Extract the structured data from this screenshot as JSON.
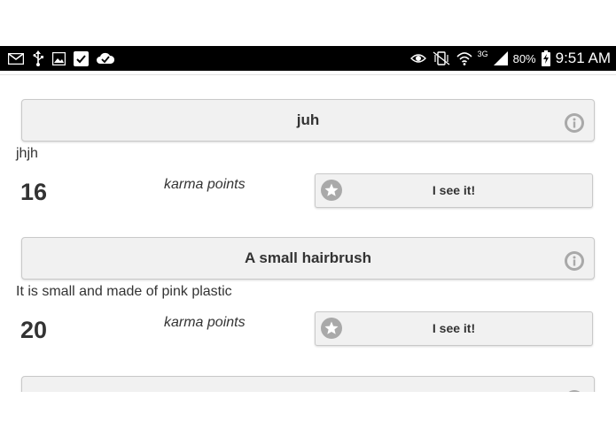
{
  "status_bar": {
    "left_icons": [
      "mail-icon",
      "usb-icon",
      "image-icon",
      "checkbox-icon",
      "cloud-check-icon"
    ],
    "right_icons": [
      "eye-icon",
      "vibrate-icon",
      "wifi-icon",
      "signal-icon",
      "battery-charging-icon"
    ],
    "network": "3G",
    "battery": "80%",
    "time": "9:51 AM"
  },
  "items": [
    {
      "title": "juh",
      "description": "jhjh",
      "points": "16",
      "points_label": "karma points",
      "button_label": "I see it!"
    },
    {
      "title": "A small hairbrush",
      "description": "It is small and made of pink plastic",
      "points": "20",
      "points_label": "karma points",
      "button_label": "I see it!"
    },
    {
      "title": "",
      "description": "",
      "points": "",
      "points_label": "",
      "button_label": ""
    }
  ],
  "colors": {
    "card_bg": "#f1f1f1",
    "card_border": "#c9c9c9",
    "icon_gray": "#a9a9a9",
    "text": "#333333",
    "status_bar_bg": "#000000"
  }
}
